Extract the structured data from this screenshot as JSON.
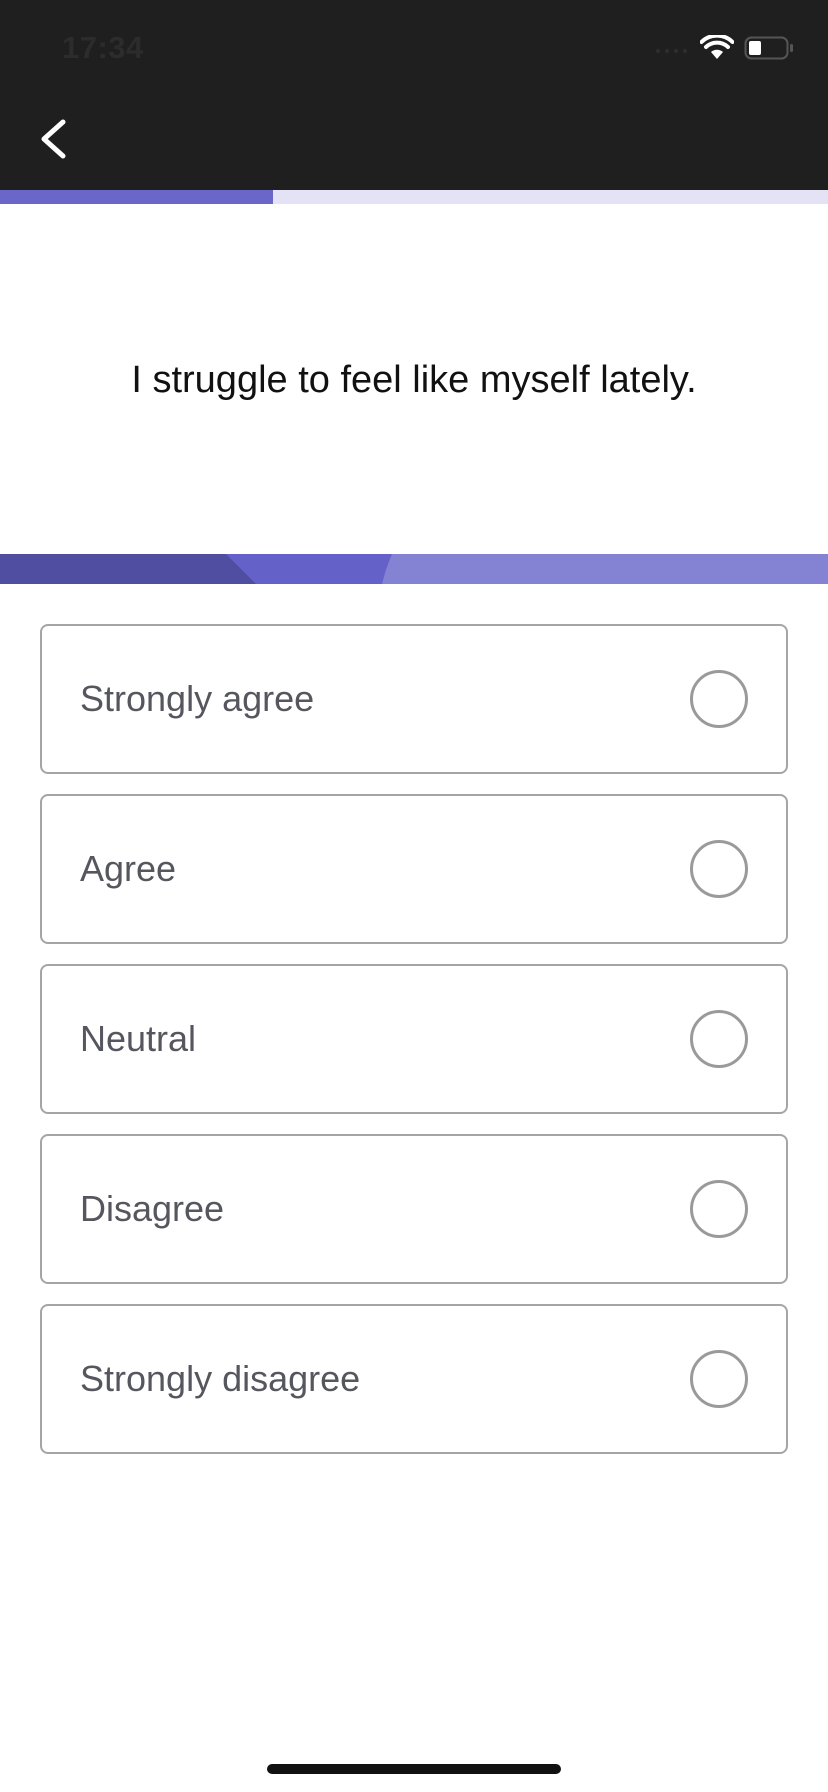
{
  "status_bar": {
    "time": "17:34",
    "icons": [
      "cellular-signal-icon",
      "wifi-icon",
      "battery-icon"
    ]
  },
  "header": {
    "back_icon": "chevron-left-icon"
  },
  "progress": {
    "value": 0.33
  },
  "question": {
    "text": "I struggle to feel like myself lately."
  },
  "options": [
    {
      "label": "Strongly agree",
      "selected": false
    },
    {
      "label": "Agree",
      "selected": false
    },
    {
      "label": "Neutral",
      "selected": false
    },
    {
      "label": "Disagree",
      "selected": false
    },
    {
      "label": "Strongly disagree",
      "selected": false
    }
  ],
  "colors": {
    "header_bg": "#1f1f1f",
    "accent": "#6b67c8",
    "accent_light": "#e4e3f5",
    "border": "#a5a5a5",
    "option_text": "#56565f"
  }
}
